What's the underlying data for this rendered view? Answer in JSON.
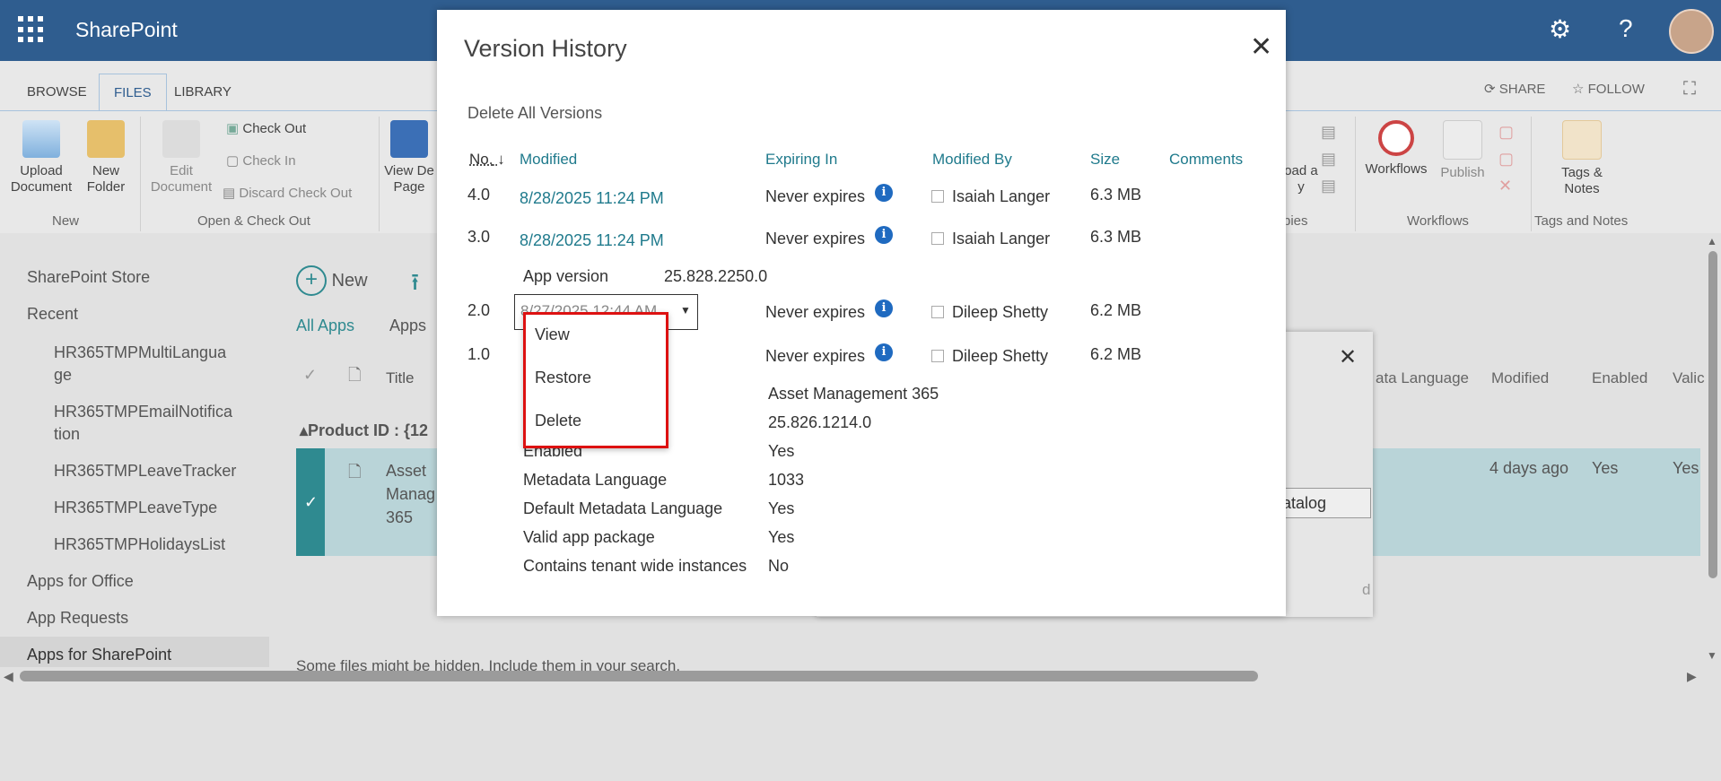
{
  "suite": {
    "brand": "SharePoint",
    "settings_icon": "gear-icon",
    "help_icon": "question-icon",
    "help_glyph": "?"
  },
  "ribbon": {
    "tabs": [
      "BROWSE",
      "FILES",
      "LIBRARY"
    ],
    "buttons": {
      "upload": "Upload Document",
      "new_folder": "New Folder",
      "edit": "Edit Document",
      "check_out": "Check Out",
      "check_in": "Check In",
      "discard": "Discard Check Out",
      "view_page": "View De\nPage",
      "upload_copy": "oad a\ny",
      "workflows": "Workflows",
      "publish": "Publish",
      "tags": "Tags &\nNotes"
    },
    "groups": {
      "new": "New",
      "checkout": "Open & Check Out",
      "copies": "pies",
      "workflows": "Workflows",
      "tags": "Tags and Notes"
    },
    "share": "SHARE",
    "follow": "FOLLOW"
  },
  "nav": {
    "items": [
      "SharePoint Store",
      "Recent"
    ],
    "recent": [
      "HR365TMPMultiLangua\nge",
      "HR365TMPEmailNotifica\ntion",
      "HR365TMPLeaveTracker",
      "HR365TMPLeaveType",
      "HR365TMPHolidaysList"
    ],
    "bottom": [
      "Apps for Office",
      "App Requests",
      "Apps for SharePoint"
    ]
  },
  "main": {
    "new": "New",
    "views": [
      "All Apps",
      "Apps"
    ],
    "col_title": "Title",
    "group": "Product ID : {12",
    "row_title": "Asset\nManag\n365",
    "right_cols": [
      "ata Language",
      "Modified",
      "Enabled",
      "Valic"
    ],
    "right_vals": [
      "4 days ago",
      "Yes",
      "Yes"
    ],
    "catalog_btn": "atalog",
    "bottom_text": "Some files might be hidden. Include them in your search.",
    "frag_d": "d"
  },
  "modal": {
    "title": "Version History",
    "close": "✕",
    "delete_all": "Delete All Versions",
    "headers": {
      "no": "No.",
      "modified": "Modified",
      "expiring": "Expiring In",
      "by": "Modified By",
      "size": "Size",
      "comments": "Comments"
    },
    "versions": [
      {
        "no": "4.0",
        "modified": "8/28/2025 11:24 PM",
        "expiring": "Never expires",
        "by": "Isaiah Langer",
        "size": "6.3 MB"
      },
      {
        "no": "3.0",
        "modified": "8/28/2025 11:24 PM",
        "expiring": "Never expires",
        "by": "Isaiah Langer",
        "size": "6.3 MB"
      },
      {
        "no": "2.0",
        "modified": "8/27/2025 12:44 AM",
        "expiring": "Never expires",
        "by": "Dileep Shetty",
        "size": "6.2 MB"
      },
      {
        "no": "1.0",
        "modified": "",
        "expiring": "Never expires",
        "by": "Dileep Shetty",
        "size": "6.2 MB"
      }
    ],
    "app_version_label": "App version",
    "app_version_value": "25.828.2250.0",
    "props": [
      {
        "label": "",
        "value": "Asset Management 365"
      },
      {
        "label": "",
        "value": "25.826.1214.0"
      },
      {
        "label": "Enabled",
        "value": "Yes"
      },
      {
        "label": "Metadata Language",
        "value": "1033"
      },
      {
        "label": "Default Metadata Language",
        "value": "Yes"
      },
      {
        "label": "Valid app package",
        "value": "Yes"
      },
      {
        "label": "Contains tenant wide instances",
        "value": "No"
      }
    ],
    "menu": [
      "View",
      "Restore",
      "Delete"
    ]
  }
}
